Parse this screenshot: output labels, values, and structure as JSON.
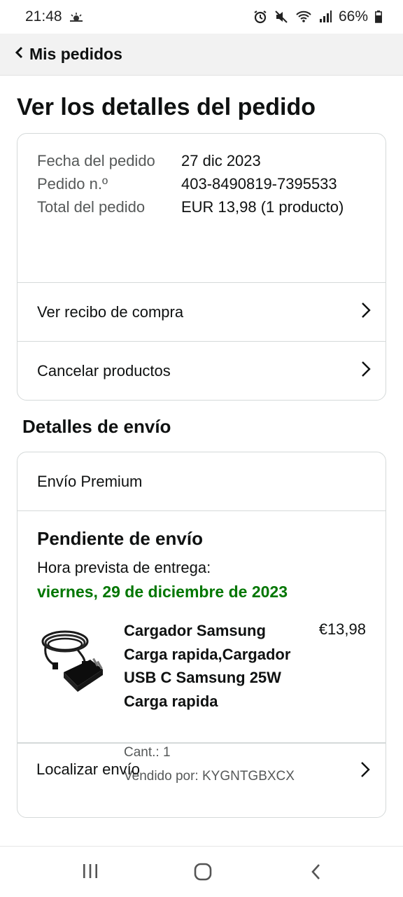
{
  "status_bar": {
    "time": "21:48",
    "battery": "66%",
    "icons": [
      "weather-icon",
      "alarm-icon",
      "mute-icon",
      "wifi-icon",
      "signal-icon",
      "battery-icon"
    ]
  },
  "nav": {
    "back_label": "Mis pedidos",
    "back_icon": "chevron-left-icon"
  },
  "page": {
    "title": "Ver los detalles del pedido"
  },
  "summary": {
    "rows": [
      {
        "label": "Fecha del pedido",
        "value": "27 dic 2023"
      },
      {
        "label": "Pedido n.º",
        "value": "403-8490819-7395533"
      },
      {
        "label": "Total del pedido",
        "value": "EUR 13,98 (1 producto)"
      }
    ],
    "receipt_link": "Ver recibo de compra",
    "cancel_link": "Cancelar productos"
  },
  "shipping": {
    "section_title": "Detalles de envío",
    "type": "Envío Premium",
    "status": "Pendiente de envío",
    "eta_label": "Hora prevista de entrega:",
    "eta_date": "viernes, 29 de diciembre de 2023",
    "product": {
      "title": "Cargador Samsung Carga rapida,Cargador USB C Samsung 25W Carga rapida",
      "price": "€13,98",
      "qty": "Cant.: 1",
      "seller": "Vendido por: KYGNTGBXCX"
    },
    "track_link": "Localizar envío"
  },
  "colors": {
    "eta_green": "#007600",
    "border": "#d5d9d9",
    "muted": "#565959",
    "nav_bg": "#f2f2f2"
  },
  "system_nav": {
    "icons": [
      "recent-apps-icon",
      "home-icon",
      "back-icon"
    ]
  }
}
